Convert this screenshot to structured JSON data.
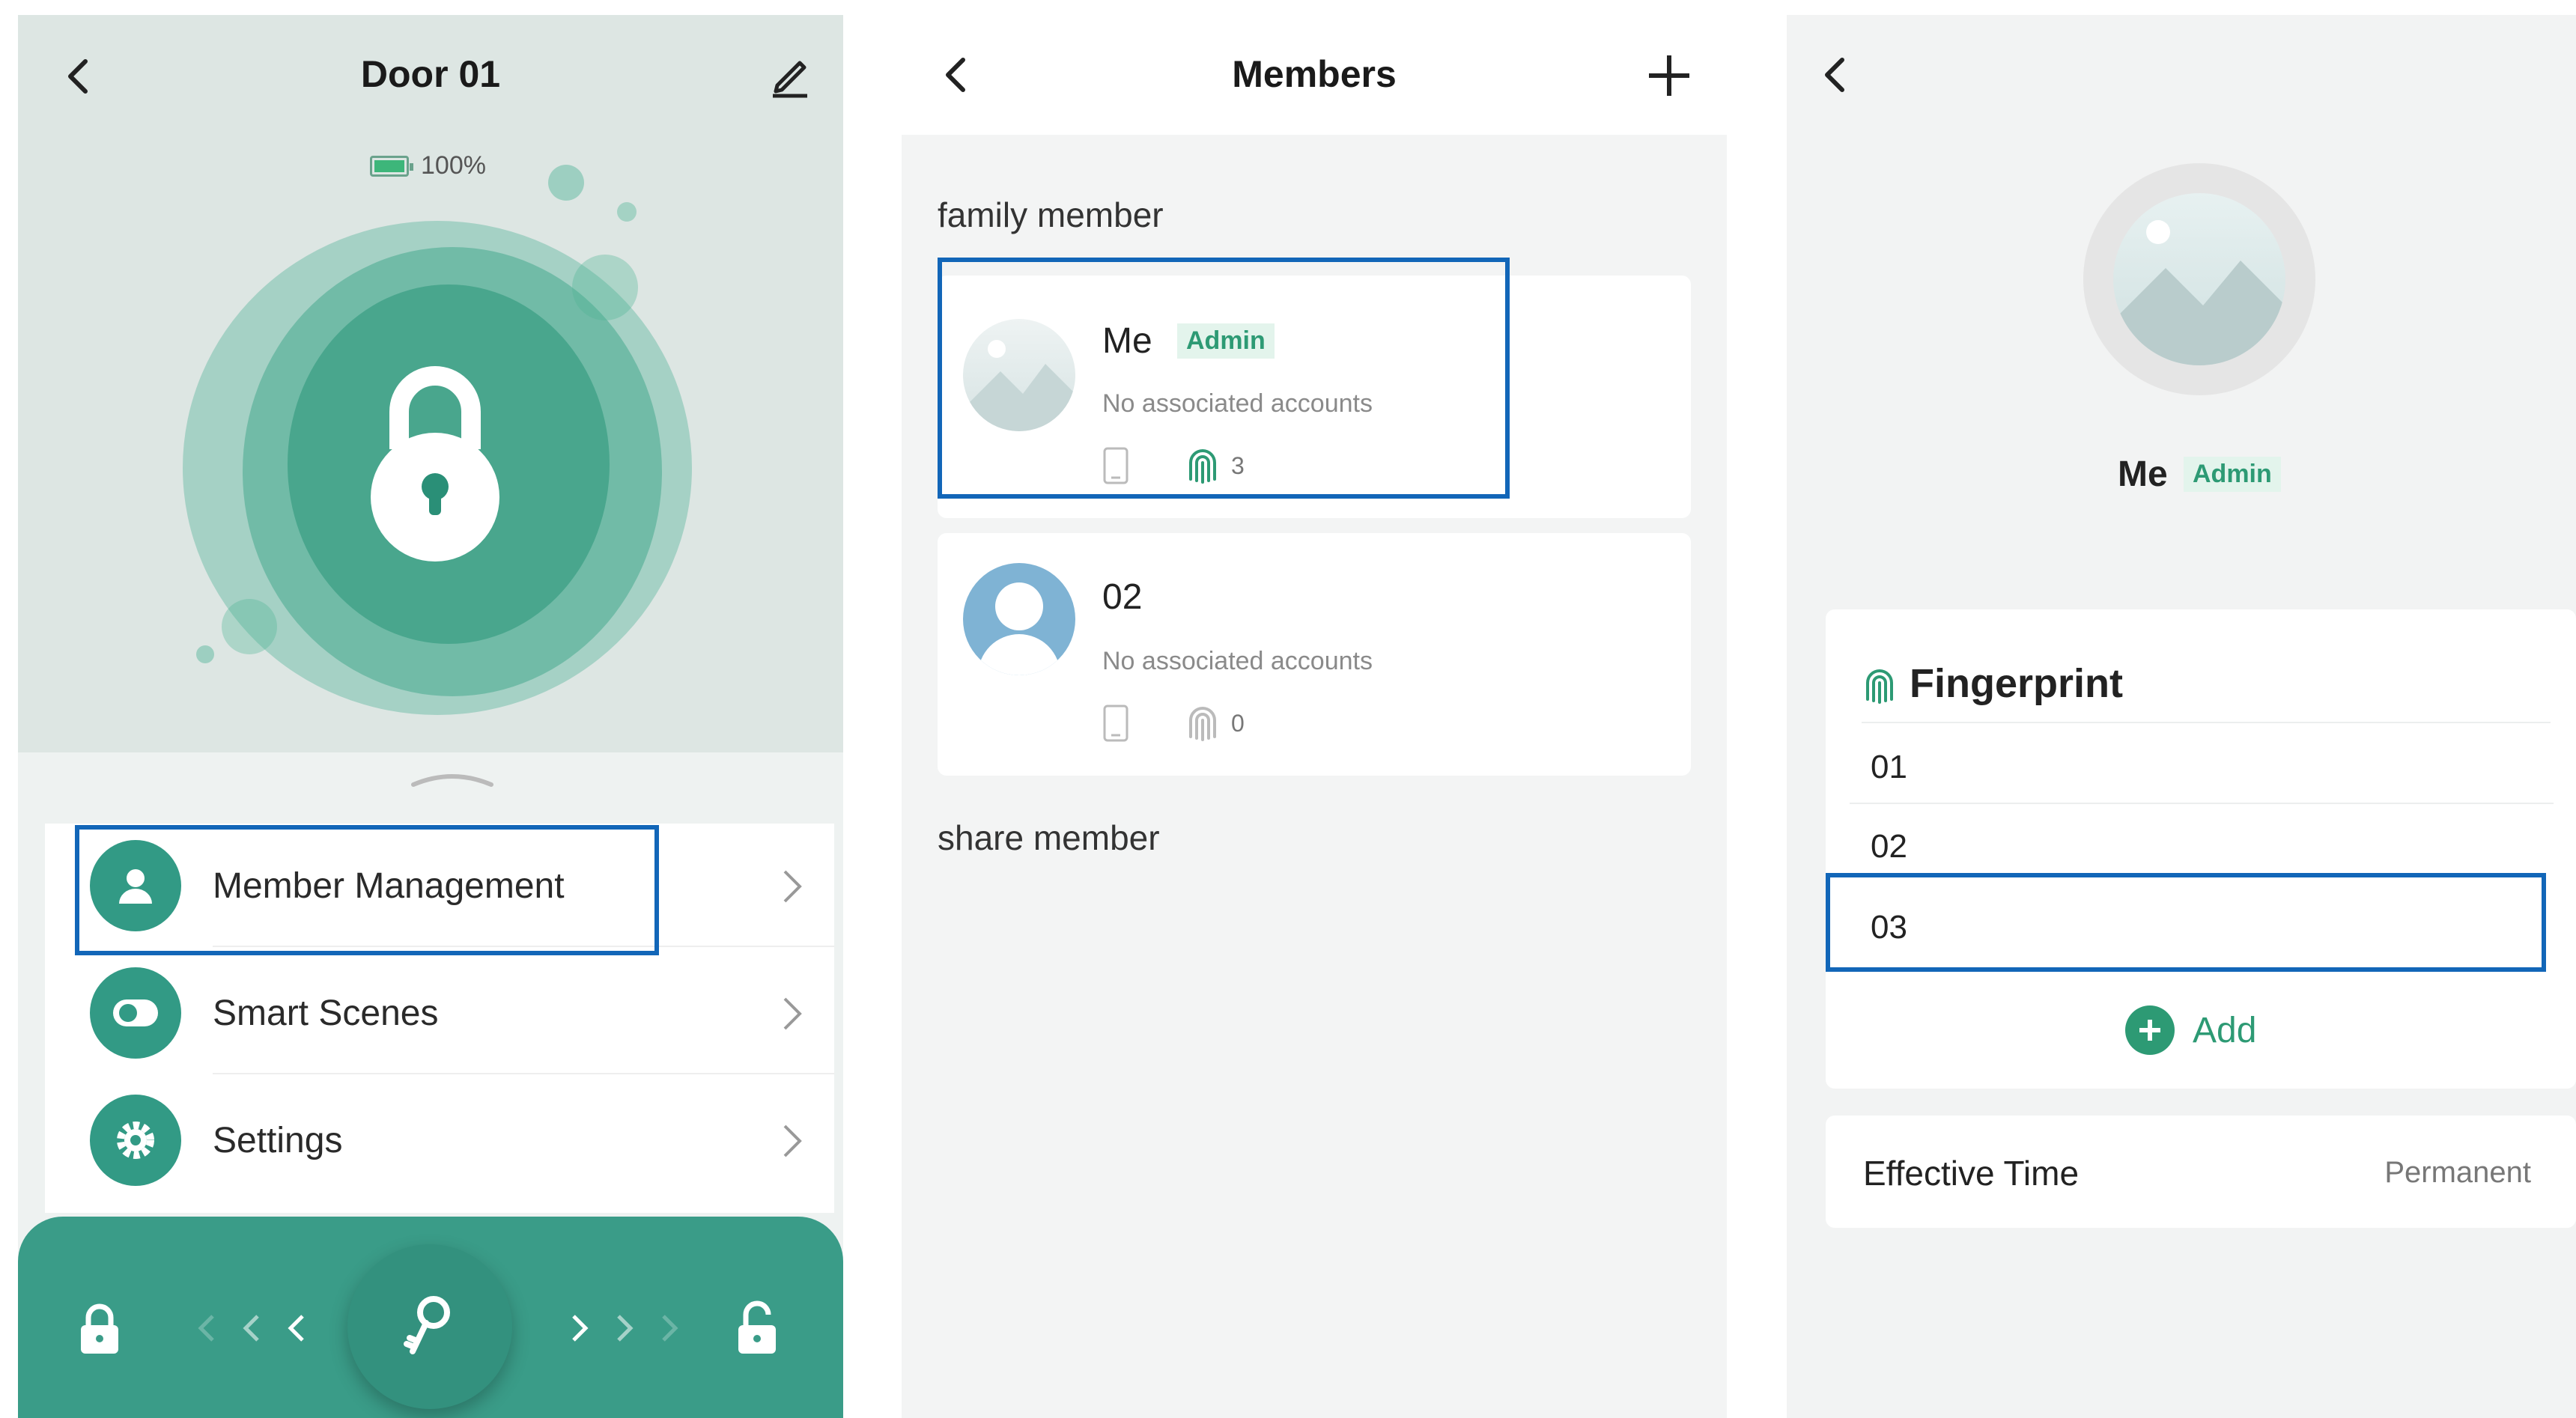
{
  "colors": {
    "accent": "#3a9c88",
    "highlight": "#1266b8",
    "badge_text": "#2d9a74"
  },
  "door_screen": {
    "title": "Door 01",
    "battery_percent": "100%",
    "menu": [
      {
        "label": "Member Management",
        "icon": "person-icon"
      },
      {
        "label": "Smart Scenes",
        "icon": "toggle-icon"
      },
      {
        "label": "Settings",
        "icon": "gear-icon"
      }
    ],
    "bottom_bar": {
      "left_icon": "lock-icon",
      "center_icon": "key-icon",
      "right_icon": "unlock-icon"
    }
  },
  "members_screen": {
    "title": "Members",
    "family_section": "family member",
    "share_section": "share member",
    "members": [
      {
        "name": "Me",
        "badge": "Admin",
        "subtitle": "No associated accounts",
        "fingerprint_count": "3"
      },
      {
        "name": "02",
        "badge": "",
        "subtitle": "No associated accounts",
        "fingerprint_count": "0"
      }
    ]
  },
  "member_detail_screen": {
    "name": "Me",
    "badge": "Admin",
    "fingerprint_title": "Fingerprint",
    "fingerprints": [
      "01",
      "02",
      "03"
    ],
    "add_label": "Add",
    "effective_time_label": "Effective Time",
    "effective_time_value": "Permanent"
  }
}
